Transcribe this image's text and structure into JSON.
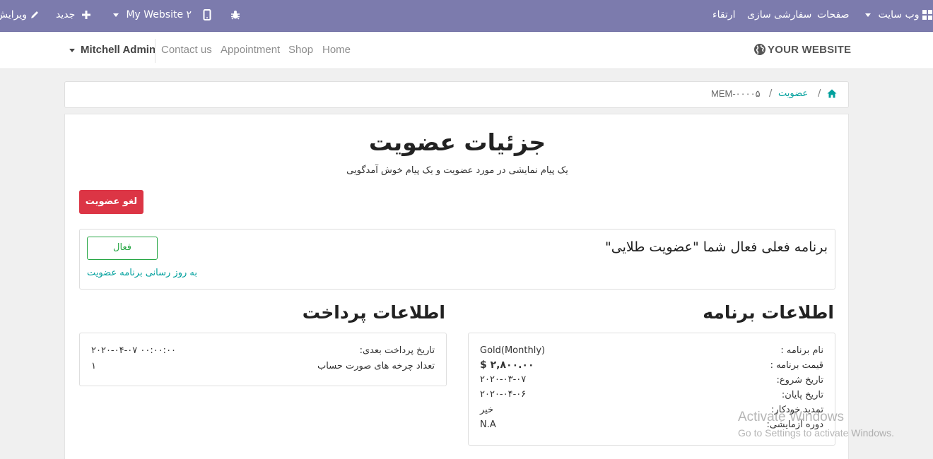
{
  "adminbar": {
    "website_menu": "وب سایت",
    "pages": "صفحات",
    "customize": "سفارشی سازی",
    "upgrade": "ارتقاء",
    "site_selector": "My Website ۲",
    "new": "جدید",
    "edit": "ویرایش"
  },
  "navbar": {
    "brand": "YOUR WEBSITE",
    "links": [
      "Home",
      "Shop",
      "Appointment",
      "Contact us"
    ],
    "user": "Mitchell Admin"
  },
  "breadcrumb": {
    "membership": "عضویت",
    "current": "MEM-۰۰۰۰۵"
  },
  "page": {
    "title": "جزئیات عضویت",
    "subtitle": "یک پیام نمایشی در مورد عضویت و یک پیام خوش آمدگویی",
    "cancel_button": "لغو عضویت"
  },
  "plan": {
    "current_text": "برنامه فعلی فعال شما \"عضویت طلایی\"",
    "status_button": "فعال",
    "update_link": "به روز رسانی برنامه عضویت"
  },
  "payment": {
    "heading": "اطلاعات پرداخت",
    "next_payment_label": "تاریخ پرداخت بعدی:",
    "next_payment_value": "۲۰۲۰-۰۴-۰۷ ۰۰:۰۰:۰۰",
    "billing_cycles_label": "تعداد چرخه های صورت حساب",
    "billing_cycles_value": "۱"
  },
  "program": {
    "heading": "اطلاعات برنامه",
    "rows": [
      {
        "label": "نام برنامه :",
        "value": "Gold(Monthly)"
      },
      {
        "label": "قیمت برنامه :",
        "value": "$ ۲,۸۰۰.۰۰"
      },
      {
        "label": "تاریخ شروع:",
        "value": "۲۰۲۰-۰۳-۰۷"
      },
      {
        "label": "تاریخ پایان:",
        "value": "۲۰۲۰-۰۴-۰۶"
      },
      {
        "label": "تمدید خودکار:",
        "value": "خیر"
      },
      {
        "label": "دوره آزمایشی:",
        "value": "N.A"
      }
    ]
  },
  "watermark": {
    "line1": "Activate Windows",
    "line2": "Go to Settings to activate Windows."
  },
  "colors": {
    "adminbar": "#7c7bad",
    "accent": "#00a09d",
    "danger": "#dc3545",
    "success": "#28a745"
  }
}
